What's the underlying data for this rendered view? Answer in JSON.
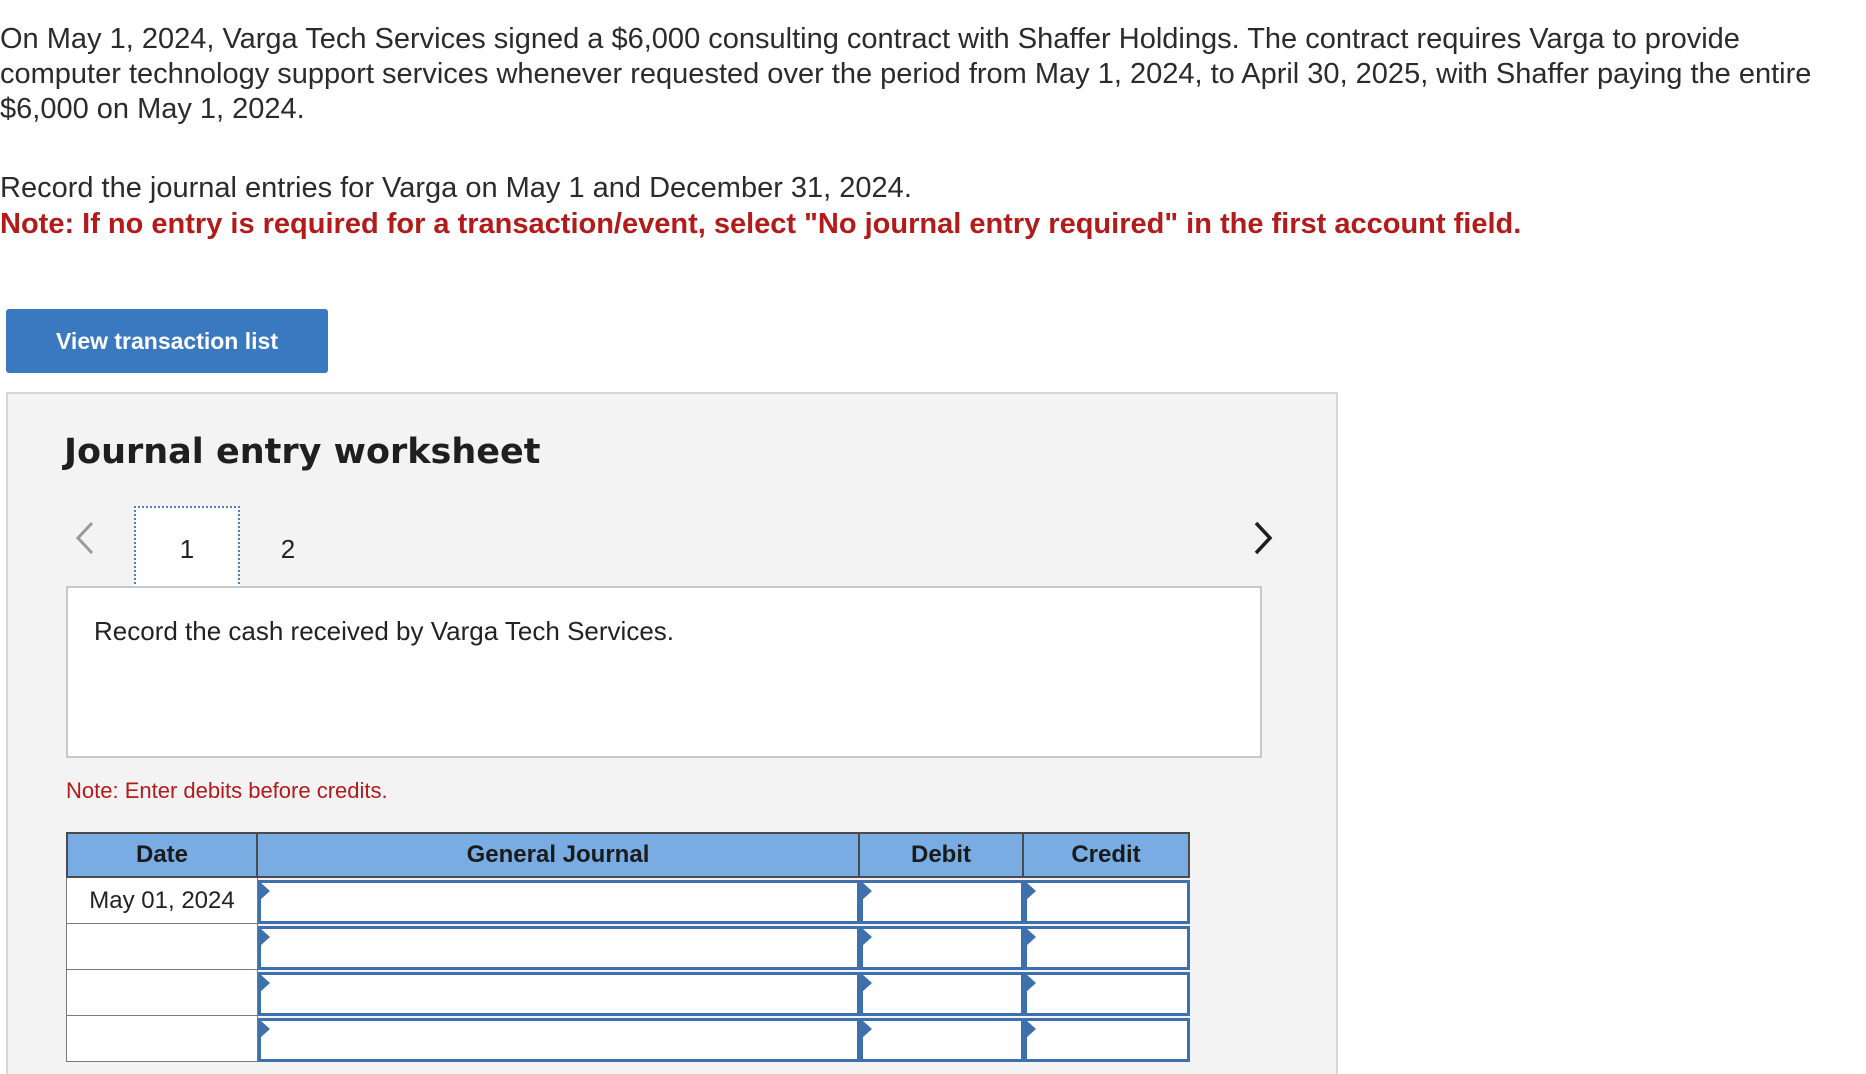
{
  "problem": {
    "paragraph": "On May 1, 2024, Varga Tech Services signed a $6,000 consulting contract with Shaffer Holdings. The contract requires Varga to provide computer technology support services whenever requested over the period from May 1, 2024, to April 30, 2025, with Shaffer paying the entire $6,000 on May 1, 2024.",
    "instruction": "Record the journal entries for Varga on May 1 and December 31, 2024.",
    "note": "Note: If no entry is required for a transaction/event, select \"No journal entry required\" in the first account field."
  },
  "view_button_label": "View transaction list",
  "worksheet": {
    "title": "Journal entry worksheet",
    "tabs": [
      "1",
      "2"
    ],
    "active_tab": "1",
    "prompt": "Record the cash received by Varga Tech Services.",
    "note": "Note: Enter debits before credits.",
    "table": {
      "headers": {
        "date": "Date",
        "account": "General Journal",
        "debit": "Debit",
        "credit": "Credit"
      },
      "rows": [
        {
          "date": "May 01, 2024",
          "account": "",
          "debit": "",
          "credit": ""
        },
        {
          "date": "",
          "account": "",
          "debit": "",
          "credit": ""
        },
        {
          "date": "",
          "account": "",
          "debit": "",
          "credit": ""
        },
        {
          "date": "",
          "account": "",
          "debit": "",
          "credit": ""
        }
      ]
    }
  },
  "colors": {
    "button_blue": "#3a79bf",
    "header_blue": "#79ace3",
    "note_red": "#b31a1a",
    "input_border": "#3e70ad"
  },
  "icons": {
    "prev": "chevron-left-icon",
    "next": "chevron-right-icon"
  }
}
